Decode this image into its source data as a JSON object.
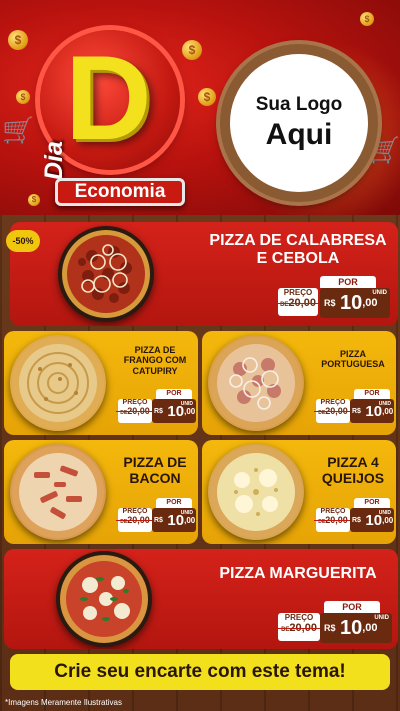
{
  "header": {
    "logo_dia": "Dia",
    "logo_letter": "D",
    "logo_sub": "Economia",
    "brand_line1": "Sua Logo",
    "brand_line2": "Aqui",
    "coin_symbol": "$"
  },
  "badge": {
    "discount": "-50%"
  },
  "products": [
    {
      "name_line1": "PIZZA DE CALABRESA",
      "name_line2": "E CEBOLA",
      "por": "POR",
      "preco": "PREÇO",
      "old_prefix": "DE",
      "old_price": "20,00",
      "currency": "R$",
      "price_int": "10",
      "price_cents": ",00",
      "unit": "UNID"
    },
    {
      "name_line1": "PIZZA DE",
      "name_line2": "FRANGO COM",
      "name_line3": "CATUPIRY",
      "por": "POR",
      "preco": "PREÇO",
      "old_prefix": "DE",
      "old_price": "20,00",
      "currency": "R$",
      "price_int": "10",
      "price_cents": ",00",
      "unit": "UNID"
    },
    {
      "name_line1": "PIZZA",
      "name_line2": "PORTUGUESA",
      "por": "POR",
      "preco": "PREÇO",
      "old_prefix": "DE",
      "old_price": "20,00",
      "currency": "R$",
      "price_int": "10",
      "price_cents": ",00",
      "unit": "UNID"
    },
    {
      "name_line1": "PIZZA DE",
      "name_line2": "BACON",
      "por": "POR",
      "preco": "PREÇO",
      "old_prefix": "DE",
      "old_price": "20,00",
      "currency": "R$",
      "price_int": "10",
      "price_cents": ",00",
      "unit": "UNID"
    },
    {
      "name_line1": "PIZZA 4",
      "name_line2": "QUEIJOS",
      "por": "POR",
      "preco": "PREÇO",
      "old_prefix": "DE",
      "old_price": "20,00",
      "currency": "R$",
      "price_int": "10",
      "price_cents": ",00",
      "unit": "UNID"
    },
    {
      "name_line1": "PIZZA MARGUERITA",
      "por": "POR",
      "preco": "PREÇO",
      "old_prefix": "DE",
      "old_price": "20,00",
      "currency": "R$",
      "price_int": "10",
      "price_cents": ",00",
      "unit": "UNID"
    }
  ],
  "cta": "Crie seu encarte com este tema!",
  "footnote": "*Imagens Meramente Ilustrativas",
  "colors": {
    "red": "#d4221a",
    "yellow": "#f4b80c",
    "brown": "#6a2a10",
    "cta": "#f2e01c"
  }
}
